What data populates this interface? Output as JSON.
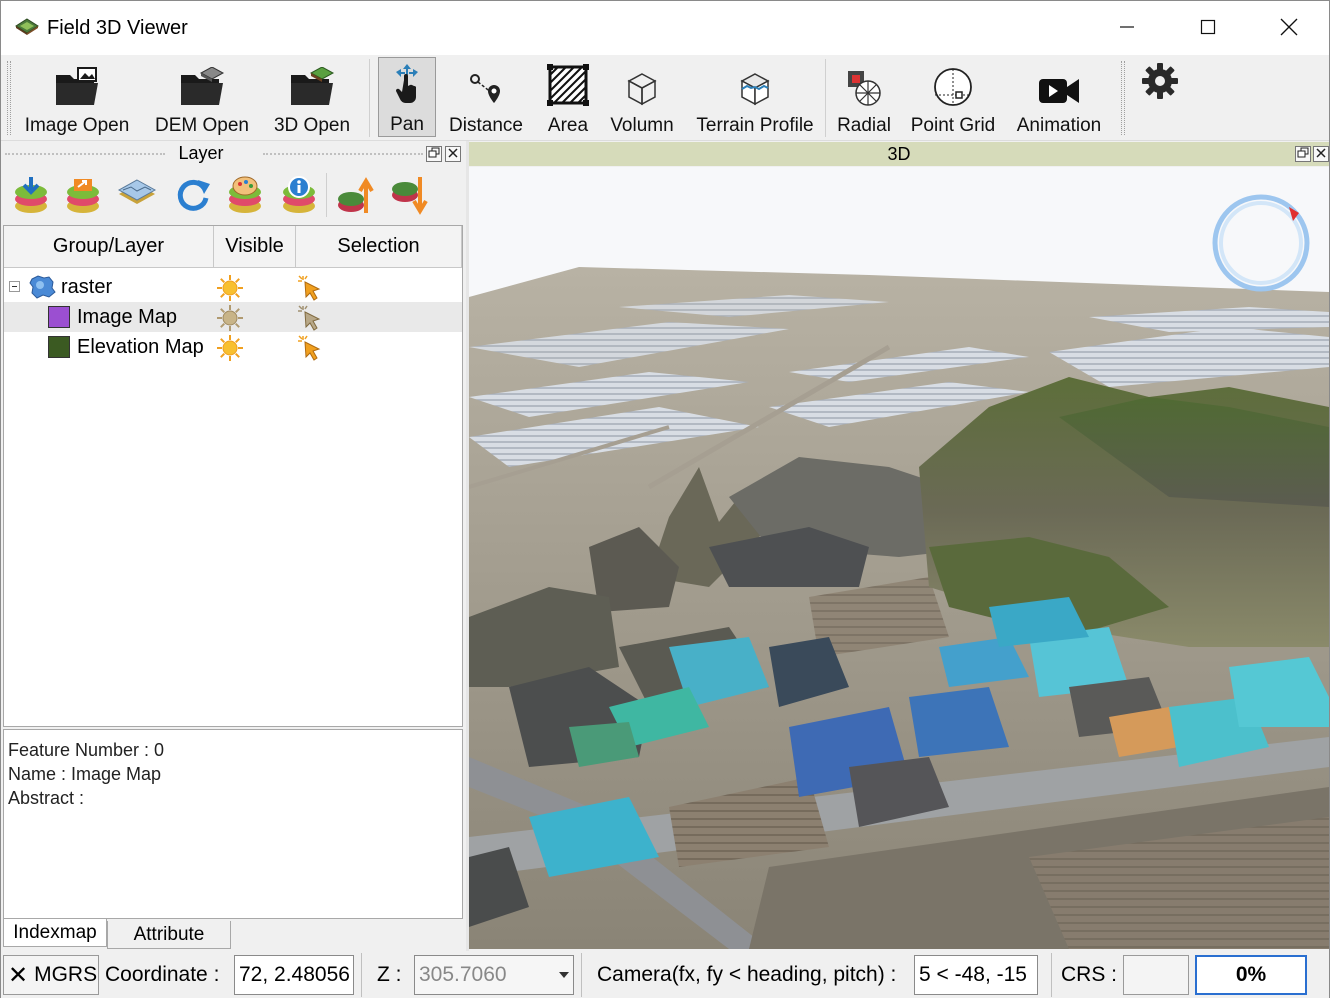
{
  "window": {
    "title": "Field 3D Viewer"
  },
  "toolbar": {
    "image_open": "Image Open",
    "dem_open": "DEM Open",
    "threed_open": "3D Open",
    "pan": "Pan",
    "distance": "Distance",
    "area": "Area",
    "volumn": "Volumn",
    "terrain_profile": "Terrain Profile",
    "radial": "Radial",
    "point_grid": "Point Grid",
    "animation": "Animation"
  },
  "layer_panel": {
    "title": "Layer",
    "columns": [
      "Group/Layer",
      "Visible",
      "Selection"
    ],
    "rows": [
      {
        "name": "raster",
        "type": "group"
      },
      {
        "name": "Image Map",
        "type": "layer",
        "swatch": "#9b4fd1"
      },
      {
        "name": "Elevation Map",
        "type": "layer",
        "swatch": "#3b5a22"
      }
    ]
  },
  "info": {
    "feature_number": "Feature Number : 0",
    "name": "Name : Image Map",
    "abstract": "Abstract :"
  },
  "tabs": [
    "Indexmap",
    "Attribute"
  ],
  "view3d": {
    "title": "3D"
  },
  "status": {
    "mgrs": "MGRS",
    "coordinate_label": "Coordinate :",
    "coordinate_value": "72, 2.48056",
    "z_label": "Z :",
    "z_value": "305.7060",
    "camera_label": "Camera(fx, fy < heading, pitch) :",
    "camera_value": "5 < -48, -15",
    "crs_label": "CRS :",
    "progress": "0%"
  }
}
